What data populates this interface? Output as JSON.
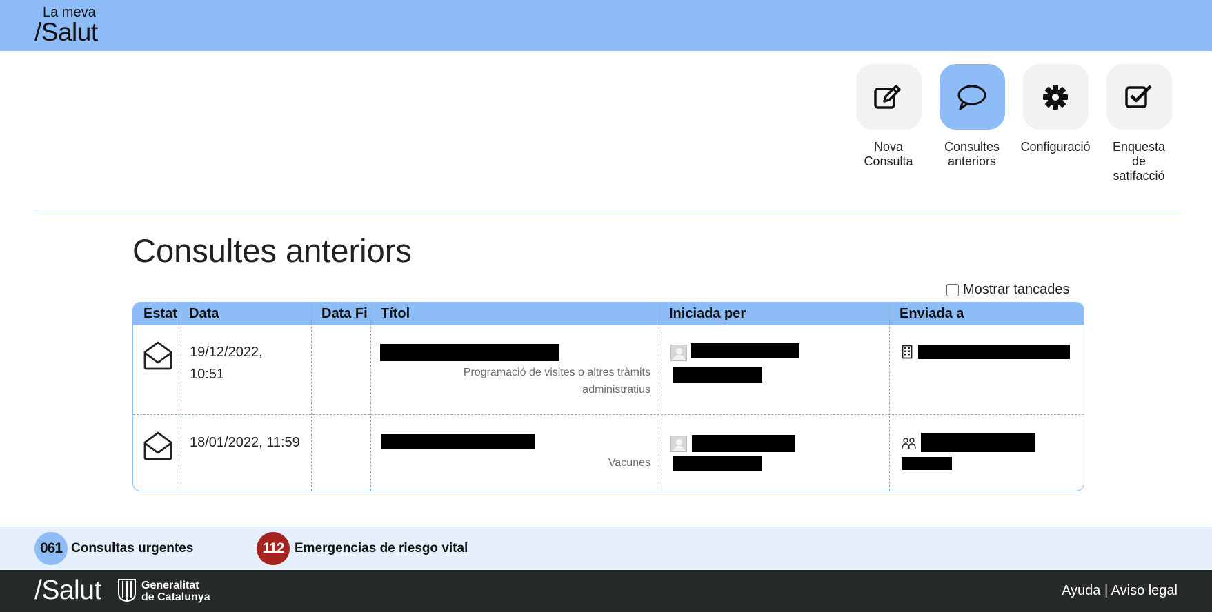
{
  "header": {
    "logo_line1": "La meva",
    "logo_line2": "/Salut",
    "background_color": "#8dbcf7"
  },
  "actions": [
    {
      "label_lines": [
        "Nova",
        "Consulta"
      ],
      "icon": "edit-icon",
      "active": false
    },
    {
      "label_lines": [
        "Consultes",
        "anteriors"
      ],
      "icon": "chat-bubble-icon",
      "active": true
    },
    {
      "label_lines": [
        "Configuració"
      ],
      "icon": "gear-icon",
      "active": false
    },
    {
      "label_lines": [
        "Enquesta",
        "de",
        "satifacció"
      ],
      "icon": "checkbox-icon",
      "active": false
    }
  ],
  "page": {
    "title": "Consultes anteriors",
    "show_closed_label": "Mostrar tancades",
    "show_closed_checked": false
  },
  "table": {
    "headers": [
      "Estat",
      "Data",
      "Data Fi",
      "Títol",
      "Iniciada per",
      "Enviada a"
    ],
    "rows": [
      {
        "status_icon": "open-envelope-icon",
        "date_line1": "19/12/2022,",
        "date_line2": "10:51",
        "end_date": "",
        "title_redacted": true,
        "subtitle_line1": "Programació de visites o altres tràmits",
        "subtitle_line2": "administratius",
        "initiated_by_redacted": true,
        "sent_to_icon": "building-icon",
        "sent_to_redacted": true
      },
      {
        "status_icon": "open-envelope-icon",
        "date_line1": "18/01/2022, 11:59",
        "date_line2": "",
        "end_date": "",
        "title_redacted": true,
        "subtitle_line1": "Vacunes",
        "subtitle_line2": "",
        "initiated_by_redacted": true,
        "sent_to_icon": "group-icon",
        "sent_to_redacted": true
      }
    ]
  },
  "urgent_bar": {
    "badge1": "061",
    "text1": "Consultas urgentes",
    "badge2": "112",
    "text2": "Emergencias de riesgo vital"
  },
  "footer": {
    "salut_logo": "/Salut",
    "gen_line1": "Generalitat",
    "gen_line2": "de Catalunya",
    "link_help": "Ayuda",
    "separator": "|",
    "link_legal": "Aviso legal"
  }
}
